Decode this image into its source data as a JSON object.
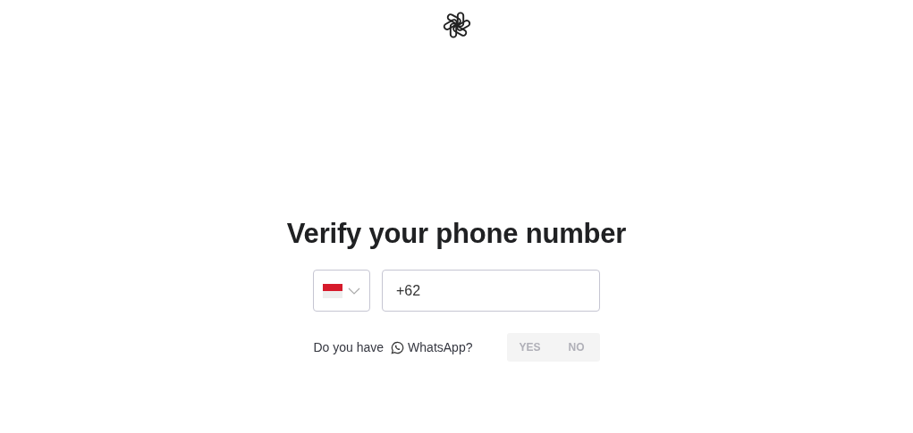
{
  "title": "Verify your phone number",
  "phone": {
    "value": "+62"
  },
  "whatsapp": {
    "prefix": "Do you have",
    "label": "WhatsApp?",
    "options": [
      {
        "label": "YES",
        "selected": false
      },
      {
        "label": "NO",
        "selected": false
      }
    ]
  }
}
